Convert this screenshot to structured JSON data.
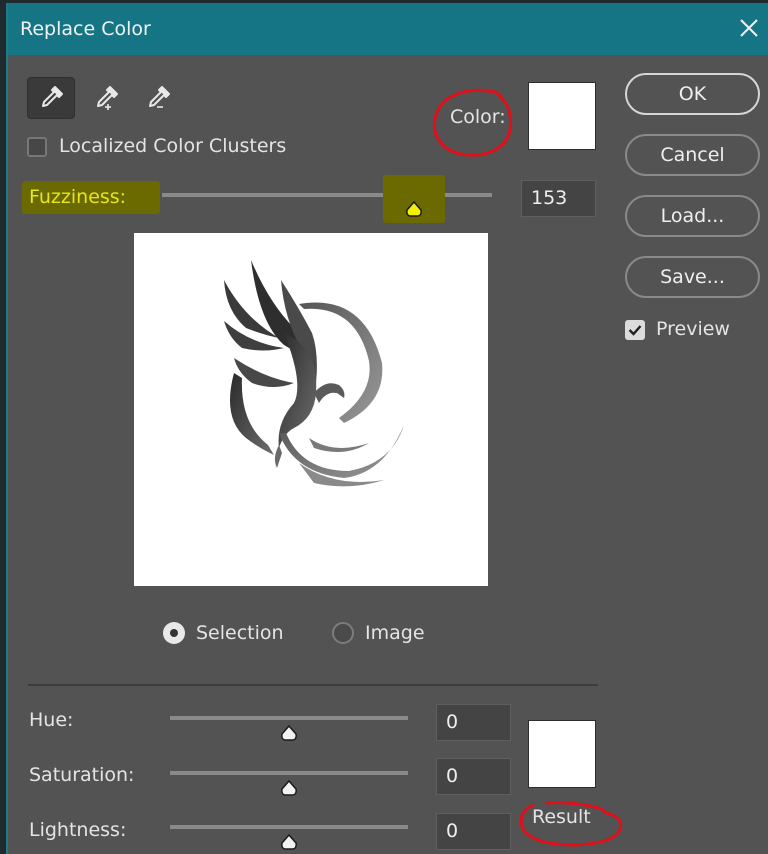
{
  "window": {
    "title": "Replace Color",
    "close_icon": "close-icon"
  },
  "tools": [
    {
      "name": "eyedropper",
      "icon": "eyedropper-icon",
      "active": true
    },
    {
      "name": "add-to-sample",
      "icon": "eyedropper-plus-icon",
      "active": false
    },
    {
      "name": "subtract-from-sample",
      "icon": "eyedropper-minus-icon",
      "active": false
    }
  ],
  "localized_clusters": {
    "label": "Localized Color Clusters",
    "checked": false
  },
  "color": {
    "label": "Color:",
    "swatch": "#ffffff"
  },
  "fuzziness": {
    "label": "Fuzziness:",
    "value": "153",
    "fraction": 0.765,
    "highlight": "#6b6a00",
    "text_color": "#e6e61a"
  },
  "view_mode": {
    "options": [
      {
        "label": "Selection",
        "selected": true
      },
      {
        "label": "Image",
        "selected": false
      }
    ]
  },
  "buttons": {
    "ok": "OK",
    "cancel": "Cancel",
    "load": "Load...",
    "save": "Save..."
  },
  "preview": {
    "label": "Preview",
    "checked": true
  },
  "adjustments": [
    {
      "label": "Hue:",
      "value": "0",
      "fraction": 0.5
    },
    {
      "label": "Saturation:",
      "value": "0",
      "fraction": 0.5
    },
    {
      "label": "Lightness:",
      "value": "0",
      "fraction": 0.5
    }
  ],
  "result": {
    "label": "Result",
    "swatch": "#ffffff"
  },
  "colors": {
    "titlebar": "#167585",
    "body": "#535353",
    "annotation_red": "#e0101a"
  }
}
